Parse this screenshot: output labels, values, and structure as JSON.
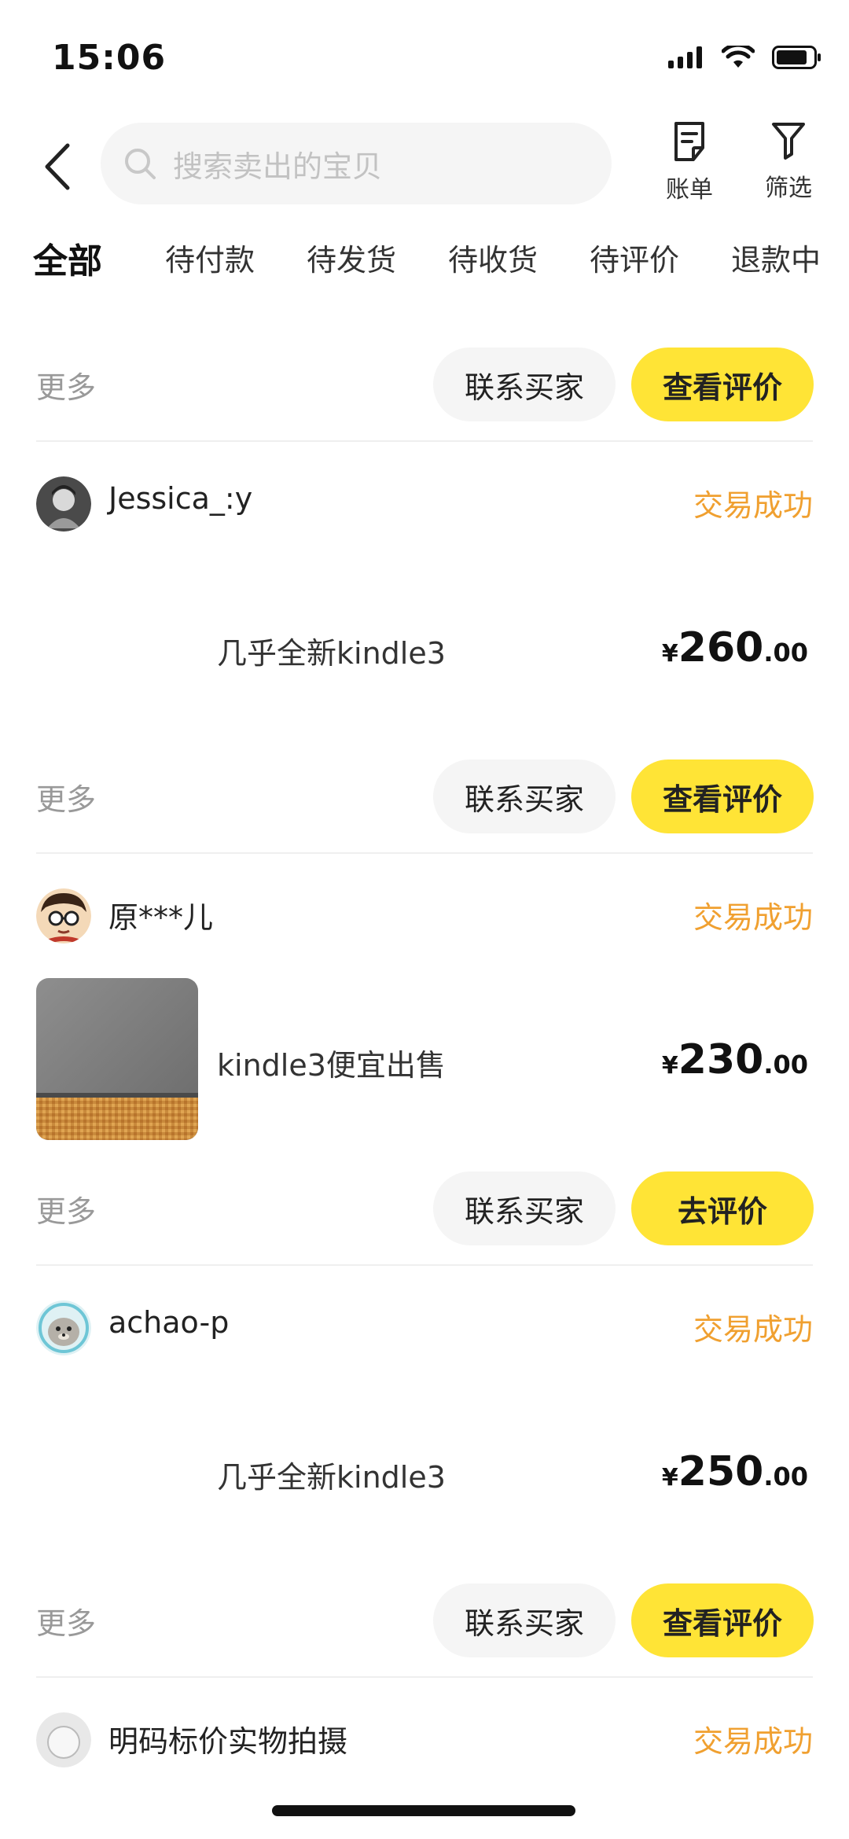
{
  "status_bar": {
    "time": "15:06"
  },
  "header": {
    "search_placeholder": "搜索卖出的宝贝",
    "bill_label": "账单",
    "filter_label": "筛选"
  },
  "tabs": [
    {
      "label": "全部",
      "active": true
    },
    {
      "label": "待付款"
    },
    {
      "label": "待发货"
    },
    {
      "label": "待收货"
    },
    {
      "label": "待评价"
    },
    {
      "label": "退款中"
    }
  ],
  "top_actions": {
    "more": "更多",
    "contact": "联系买家",
    "primary": "查看评价"
  },
  "orders": [
    {
      "seller": "Jessica_:y",
      "status": "交易成功",
      "title": "几乎全新kindle3",
      "price_currency": "¥",
      "price_int": "260",
      "price_dec": ".00",
      "more": "更多",
      "contact": "联系买家",
      "primary": "查看评价"
    },
    {
      "seller": "原***儿",
      "status": "交易成功",
      "title": "kindle3便宜出售",
      "price_currency": "¥",
      "price_int": "230",
      "price_dec": ".00",
      "more": "更多",
      "contact": "联系买家",
      "primary": "去评价"
    },
    {
      "seller": "achao-p",
      "status": "交易成功",
      "title": "几乎全新kindle3",
      "price_currency": "¥",
      "price_int": "250",
      "price_dec": ".00",
      "more": "更多",
      "contact": "联系买家",
      "primary": "查看评价"
    },
    {
      "seller": "明码标价实物拍摄",
      "status": "交易成功"
    }
  ]
}
